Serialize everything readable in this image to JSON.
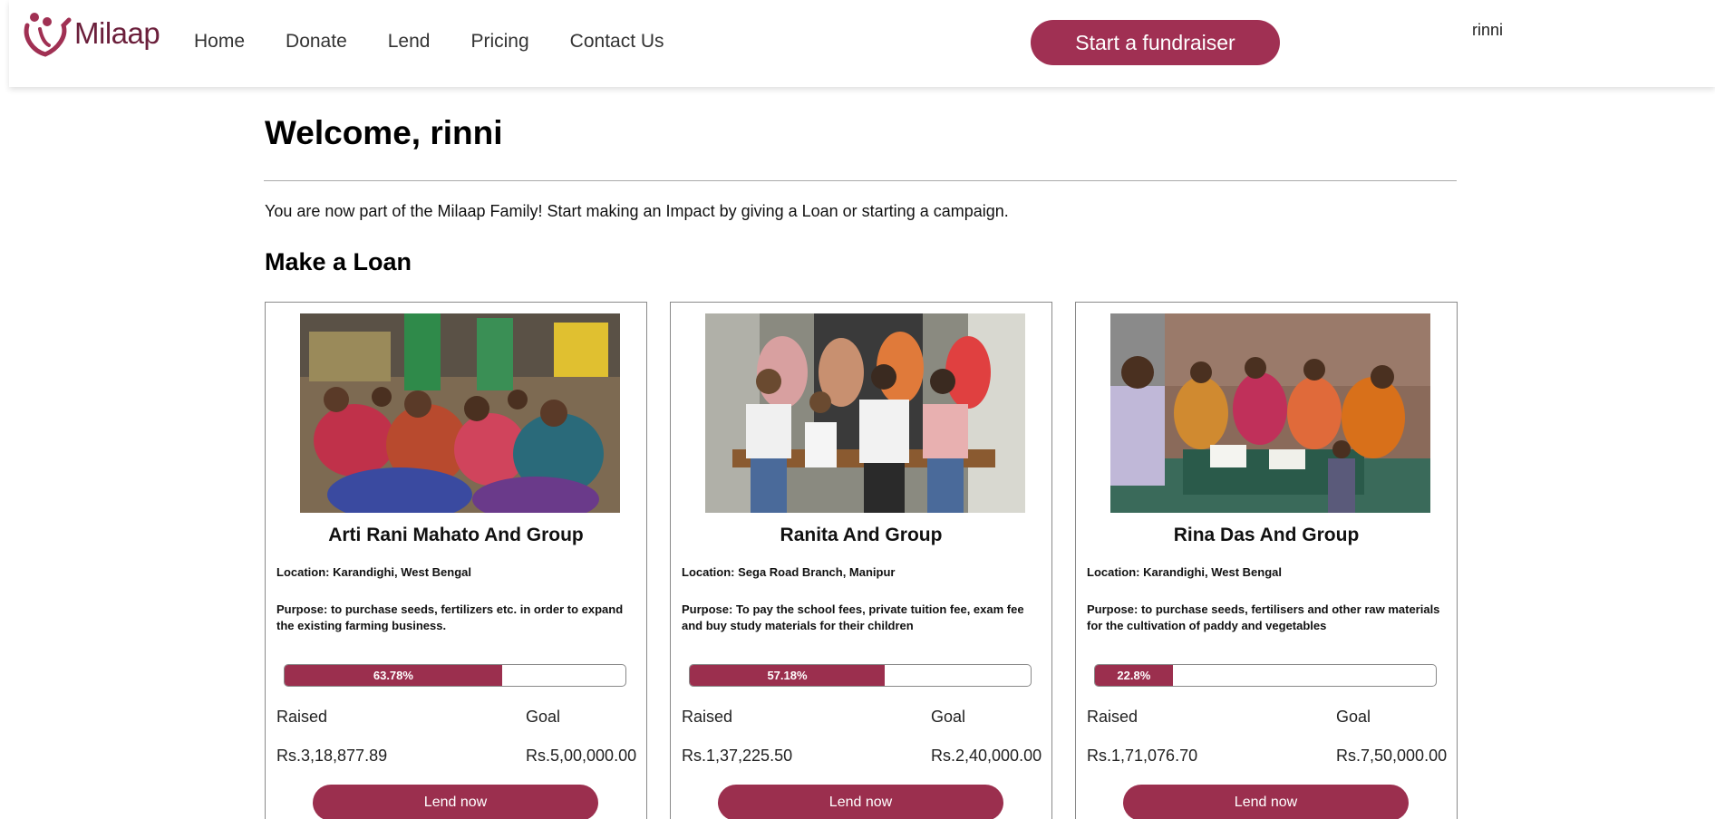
{
  "header": {
    "logo_text": "Milaap",
    "nav": [
      "Home",
      "Donate",
      "Lend",
      "Pricing",
      "Contact Us"
    ],
    "fundraiser_button": "Start a fundraiser",
    "username": "rinni"
  },
  "main": {
    "welcome": "Welcome, rinni",
    "intro": "You are now part of the Milaap Family! Start making an Impact by giving a Loan or starting a campaign.",
    "section_title": "Make a Loan"
  },
  "colors": {
    "brand": "#9b2f4e",
    "progress": "#9b2f4e"
  },
  "loans": [
    {
      "title": "Arti Rani Mahato And Group",
      "location": "Location: Karandighi, West Bengal",
      "purpose": "Purpose: to purchase seeds, fertilizers etc. in order to expand the existing farming business.",
      "progress": 63.78,
      "progress_label": "63.78%",
      "raised_label": "Raised",
      "goal_label": "Goal",
      "raised": "Rs.3,18,877.89",
      "goal": "Rs.5,00,000.00",
      "button": "Lend now"
    },
    {
      "title": "Ranita And Group",
      "location": "Location: Sega Road Branch, Manipur",
      "purpose": "Purpose: To pay the school fees, private tuition fee, exam fee and buy study materials for their children",
      "progress": 57.18,
      "progress_label": "57.18%",
      "raised_label": "Raised",
      "goal_label": "Goal",
      "raised": "Rs.1,37,225.50",
      "goal": "Rs.2,40,000.00",
      "button": "Lend now"
    },
    {
      "title": "Rina Das And Group",
      "location": "Location: Karandighi, West Bengal",
      "purpose": "Purpose: to purchase seeds, fertilisers and other raw materials for the cultivation of paddy and vegetables",
      "progress": 22.8,
      "progress_label": "22.8%",
      "raised_label": "Raised",
      "goal_label": "Goal",
      "raised": "Rs.1,71,076.70",
      "goal": "Rs.7,50,000.00",
      "button": "Lend now"
    }
  ]
}
